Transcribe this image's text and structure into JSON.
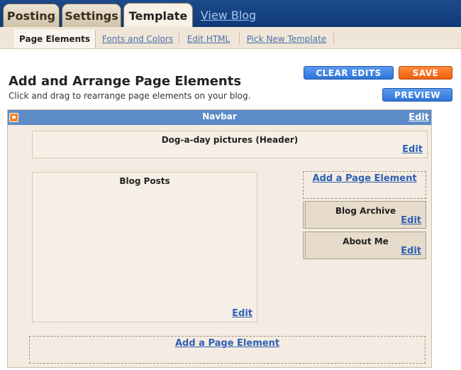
{
  "tabs": [
    {
      "label": "Posting"
    },
    {
      "label": "Settings"
    },
    {
      "label": "Template"
    },
    {
      "label": "View Blog"
    }
  ],
  "subtabs": [
    {
      "label": "Page Elements"
    },
    {
      "label": "Fonts and Colors"
    },
    {
      "label": "Edit HTML"
    },
    {
      "label": "Pick New Template"
    }
  ],
  "page": {
    "title": "Add and Arrange Page Elements",
    "subtitle": "Click and drag to rearrange page elements on your blog."
  },
  "buttons": {
    "clear_edits": "CLEAR EDITS",
    "save": "SAVE",
    "preview": "PREVIEW"
  },
  "layout": {
    "navbar": {
      "label": "Navbar",
      "edit": "Edit"
    },
    "header": {
      "title": "Dog-a-day pictures (Header)",
      "edit": "Edit"
    },
    "blog_posts": {
      "title": "Blog Posts",
      "edit": "Edit"
    },
    "sidebar_add": "Add a Page Element",
    "gadgets": [
      {
        "title": "Blog Archive",
        "edit": "Edit"
      },
      {
        "title": "About Me",
        "edit": "Edit"
      }
    ],
    "footer_add": "Add a Page Element"
  },
  "colors": {
    "topbar": "#0f3a78",
    "navbar": "#5d8bc8",
    "clear_button": "#2f74d8",
    "save_button": "#f06010",
    "link": "#2e5fb4"
  }
}
